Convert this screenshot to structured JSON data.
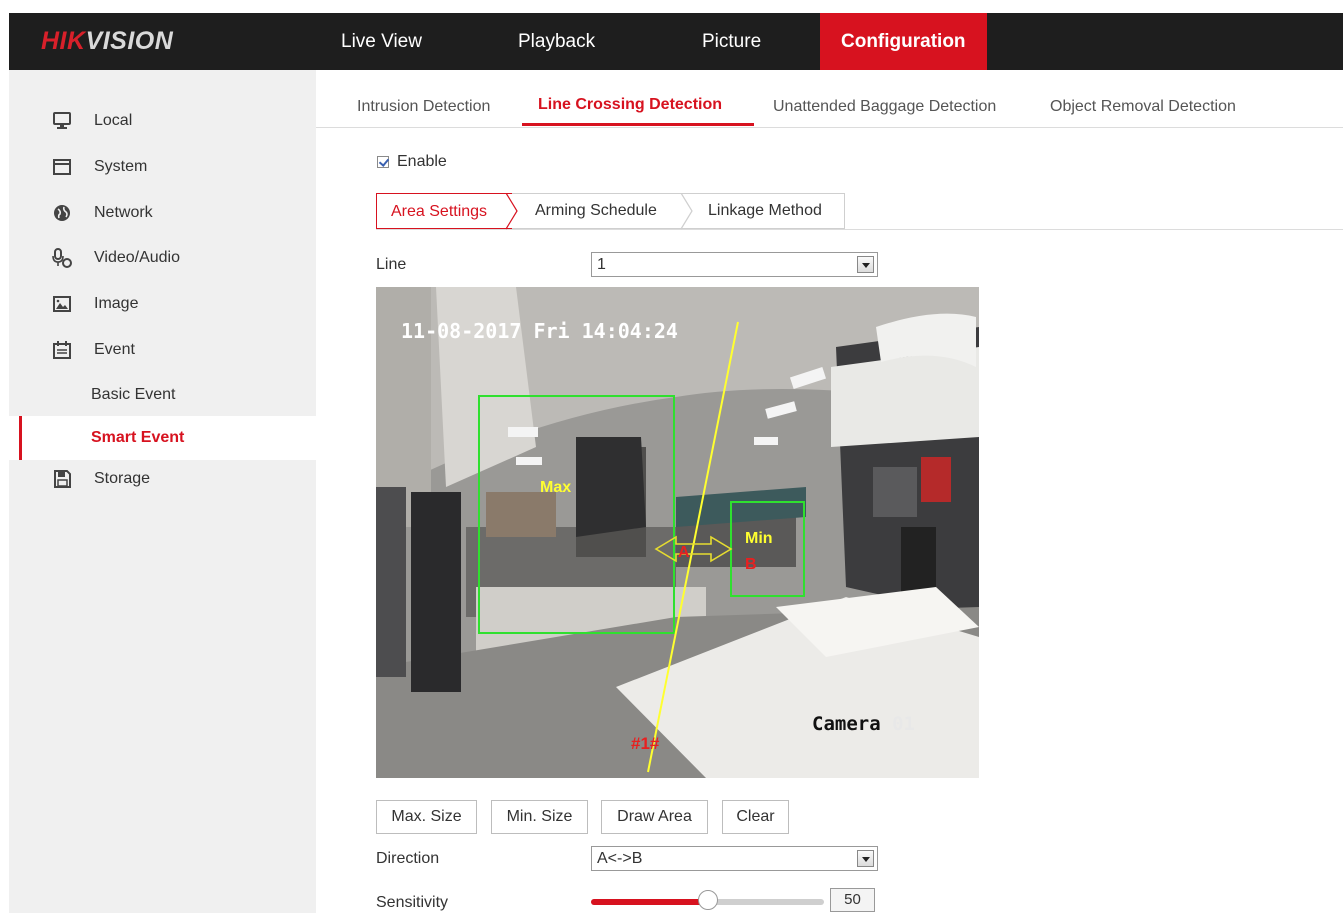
{
  "header": {
    "logo_hik": "HIK",
    "logo_vision": "VISION",
    "nav": [
      {
        "label": "Live View"
      },
      {
        "label": "Playback"
      },
      {
        "label": "Picture"
      },
      {
        "label": "Configuration"
      }
    ],
    "active_color": "#d7121f"
  },
  "sidebar": {
    "items": [
      {
        "label": "Local",
        "icon": "monitor-icon"
      },
      {
        "label": "System",
        "icon": "window-icon"
      },
      {
        "label": "Network",
        "icon": "globe-icon"
      },
      {
        "label": "Video/Audio",
        "icon": "microphone-icon"
      },
      {
        "label": "Image",
        "icon": "image-icon"
      },
      {
        "label": "Event",
        "icon": "calendar-icon"
      },
      {
        "label": "Basic Event"
      },
      {
        "label": "Smart Event"
      },
      {
        "label": "Storage",
        "icon": "disk-icon"
      }
    ]
  },
  "tabs": [
    {
      "label": "Intrusion Detection"
    },
    {
      "label": "Line Crossing Detection"
    },
    {
      "label": "Unattended Baggage Detection"
    },
    {
      "label": "Object Removal Detection"
    }
  ],
  "enable": {
    "label": "Enable",
    "checked": true
  },
  "steps": [
    {
      "label": "Area Settings"
    },
    {
      "label": "Arming Schedule"
    },
    {
      "label": "Linkage Method"
    }
  ],
  "line": {
    "label": "Line",
    "value": "1"
  },
  "video": {
    "timestamp": "11-08-2017 Fri 14:04:24",
    "camera_label": "Camera",
    "camera_num": "01",
    "line_tag": "#1#",
    "max_label": "Max",
    "min_label": "Min",
    "side_a": "A",
    "side_b": "B"
  },
  "buttons": {
    "max_size": "Max. Size",
    "min_size": "Min. Size",
    "draw_area": "Draw Area",
    "clear": "Clear"
  },
  "direction": {
    "label": "Direction",
    "value": "A<->B"
  },
  "sensitivity": {
    "label": "Sensitivity",
    "value": "50",
    "fraction": 0.5
  }
}
